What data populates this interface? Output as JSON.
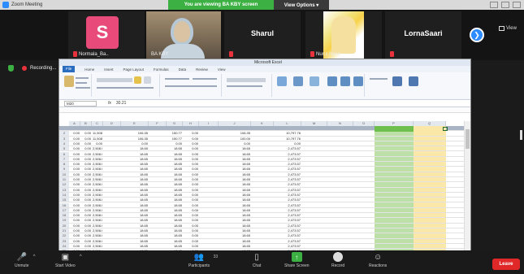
{
  "window": {
    "title": "Zoom Meeting",
    "share_banner": "You are viewing BA KBY screen",
    "view_options": "View Options ▾"
  },
  "participants": [
    {
      "name": "Normala_Ba..",
      "initial": "S",
      "muted": true,
      "kind": "avatar"
    },
    {
      "name": "BA KBY",
      "muted": false,
      "kind": "camera"
    },
    {
      "name": "Sharul",
      "muted": true,
      "kind": "name-only"
    },
    {
      "name": "Nurul Nasir",
      "muted": true,
      "kind": "image"
    },
    {
      "name": "LornaSaari",
      "muted": true,
      "kind": "name-only"
    }
  ],
  "strip_controls": {
    "view_label": "View"
  },
  "recording": {
    "label": "Recording..."
  },
  "excel": {
    "book_title": "Microsoft Excel",
    "tabs": [
      "File",
      "Home",
      "Insert",
      "Page Layout",
      "Formulas",
      "Data",
      "Review",
      "View"
    ],
    "name_box": "M20",
    "formula_value": "30.21",
    "headers": [
      "A",
      "B",
      "C",
      "D",
      "E",
      "F",
      "G",
      "H",
      "I",
      "J",
      "K",
      "L",
      "M",
      "N",
      "O",
      "P",
      "Q"
    ],
    "rows": [
      [
        "0.00",
        "0.00",
        "11,508.00",
        "",
        "106.35",
        "",
        "150.77",
        "0.00",
        "",
        "106.35",
        "",
        "10,797.76",
        "",
        "",
        "",
        "",
        ""
      ],
      [
        "0.00",
        "0.00",
        "11,508.00",
        "",
        "106.35",
        "",
        "150.77",
        "0.00",
        "",
        "100.00",
        "",
        "10,797.76",
        "",
        "",
        "",
        "",
        ""
      ],
      [
        "0.00",
        "0.00",
        "0.00",
        "",
        "0.00",
        "",
        "0.00",
        "0.00",
        "",
        "0.00",
        "",
        "0.00",
        "",
        "",
        "",
        "",
        ""
      ],
      [
        "0.00",
        "0.00",
        "2,508.00",
        "",
        "18.65",
        "",
        "18.65",
        "0.00",
        "",
        "18.65",
        "",
        "2,473.57",
        "",
        "",
        "",
        "",
        ""
      ],
      [
        "0.00",
        "0.00",
        "2,508.00",
        "",
        "18.65",
        "",
        "18.65",
        "0.00",
        "",
        "18.65",
        "",
        "2,473.57",
        "",
        "",
        "",
        "",
        ""
      ],
      [
        "0.00",
        "0.00",
        "2,508.00",
        "",
        "18.65",
        "",
        "18.65",
        "0.00",
        "",
        "18.65",
        "",
        "2,473.57",
        "",
        "",
        "",
        "",
        ""
      ],
      [
        "0.00",
        "0.00",
        "2,508.00",
        "",
        "18.65",
        "",
        "18.65",
        "0.00",
        "",
        "18.65",
        "",
        "2,473.57",
        "",
        "",
        "",
        "",
        ""
      ],
      [
        "0.00",
        "0.00",
        "2,508.00",
        "",
        "18.65",
        "",
        "18.65",
        "0.00",
        "",
        "18.65",
        "",
        "2,473.57",
        "",
        "",
        "",
        "",
        ""
      ],
      [
        "0.00",
        "0.00",
        "2,508.00",
        "",
        "18.65",
        "",
        "18.65",
        "0.00",
        "",
        "18.65",
        "",
        "2,473.57",
        "",
        "",
        "",
        "",
        ""
      ],
      [
        "0.00",
        "0.00",
        "2,508.00",
        "",
        "18.65",
        "",
        "18.65",
        "0.00",
        "",
        "18.65",
        "",
        "2,473.57",
        "",
        "",
        "",
        "",
        ""
      ],
      [
        "0.00",
        "0.00",
        "2,508.00",
        "",
        "18.65",
        "",
        "18.65",
        "0.00",
        "",
        "18.65",
        "",
        "2,473.57",
        "",
        "",
        "",
        "",
        ""
      ],
      [
        "0.00",
        "0.00",
        "2,508.00",
        "",
        "18.65",
        "",
        "18.65",
        "0.00",
        "",
        "18.65",
        "",
        "2,473.57",
        "",
        "",
        "",
        "",
        ""
      ],
      [
        "0.00",
        "0.00",
        "2,508.00",
        "",
        "18.65",
        "",
        "18.65",
        "0.00",
        "",
        "18.65",
        "",
        "2,473.57",
        "",
        "",
        "",
        "",
        ""
      ],
      [
        "0.00",
        "0.00",
        "2,508.00",
        "",
        "18.65",
        "",
        "18.65",
        "0.00",
        "",
        "18.65",
        "",
        "2,473.57",
        "",
        "",
        "",
        "",
        ""
      ],
      [
        "0.00",
        "0.00",
        "2,508.00",
        "",
        "18.65",
        "",
        "18.65",
        "0.00",
        "",
        "18.65",
        "",
        "2,473.57",
        "",
        "",
        "",
        "",
        ""
      ],
      [
        "0.00",
        "0.00",
        "2,508.00",
        "",
        "18.65",
        "",
        "18.65",
        "0.00",
        "",
        "18.65",
        "",
        "2,473.57",
        "",
        "",
        "",
        "",
        ""
      ],
      [
        "0.00",
        "0.00",
        "2,508.00",
        "",
        "18.65",
        "",
        "18.65",
        "0.00",
        "",
        "18.65",
        "",
        "2,473.57",
        "",
        "",
        "",
        "",
        ""
      ],
      [
        "0.00",
        "0.00",
        "2,508.00",
        "",
        "18.65",
        "",
        "18.65",
        "0.00",
        "",
        "18.65",
        "",
        "2,473.57",
        "",
        "",
        "",
        "",
        ""
      ],
      [
        "0.00",
        "0.00",
        "2,508.00",
        "",
        "18.65",
        "",
        "18.65",
        "0.00",
        "",
        "18.65",
        "",
        "2,473.57",
        "",
        "",
        "",
        "",
        ""
      ],
      [
        "0.00",
        "0.00",
        "2,508.00",
        "",
        "18.65",
        "",
        "18.65",
        "0.00",
        "",
        "18.65",
        "",
        "2,473.57",
        "",
        "",
        "",
        "",
        ""
      ],
      [
        "0.00",
        "0.00",
        "2,508.00",
        "",
        "18.65",
        "",
        "18.65",
        "0.00",
        "",
        "18.65",
        "",
        "2,473.57",
        "",
        "",
        "",
        "",
        ""
      ],
      [
        "0.00",
        "0.00",
        "2,508.00",
        "",
        "18.65",
        "",
        "18.65",
        "0.00",
        "",
        "18.65",
        "",
        "2,473.57",
        "",
        "",
        "",
        "",
        ""
      ],
      [
        "0.00",
        "0.00",
        "2,508.00",
        "",
        "18.65",
        "",
        "18.65",
        "0.00",
        "",
        "18.65",
        "",
        "2,473.57",
        "",
        "",
        "",
        "",
        ""
      ],
      [
        "0.00",
        "0.00",
        "2,508.00",
        "",
        "18.65",
        "",
        "18.65",
        "0.00",
        "",
        "18.65",
        "",
        "2,473.57",
        "",
        "",
        "",
        "",
        ""
      ],
      [
        "0.00",
        "0.00",
        "2,508.00",
        "",
        "18.65",
        "",
        "18.65",
        "0.00",
        "",
        "18.65",
        "",
        "2,473.57",
        "",
        "",
        "",
        "",
        ""
      ],
      [
        "0.00",
        "0.00",
        "2,508.00",
        "",
        "18.65",
        "",
        "18.65",
        "0.00",
        "",
        "18.65",
        "",
        "2,473.57",
        "",
        "",
        "",
        "",
        ""
      ]
    ],
    "row_numbers_start": 1
  },
  "toolbar": {
    "unmute": "Unmute",
    "start_video": "Start Video",
    "participants": "Participants",
    "participants_count": "33",
    "chat": "Chat",
    "share_screen": "Share Screen",
    "record": "Record",
    "reactions": "Reactions",
    "leave": "Leave"
  },
  "colors": {
    "share_green": "#3cb043",
    "zoom_blue": "#2d8cff",
    "leave_red": "#e02828",
    "avatar_pink": "#e84b7a"
  }
}
